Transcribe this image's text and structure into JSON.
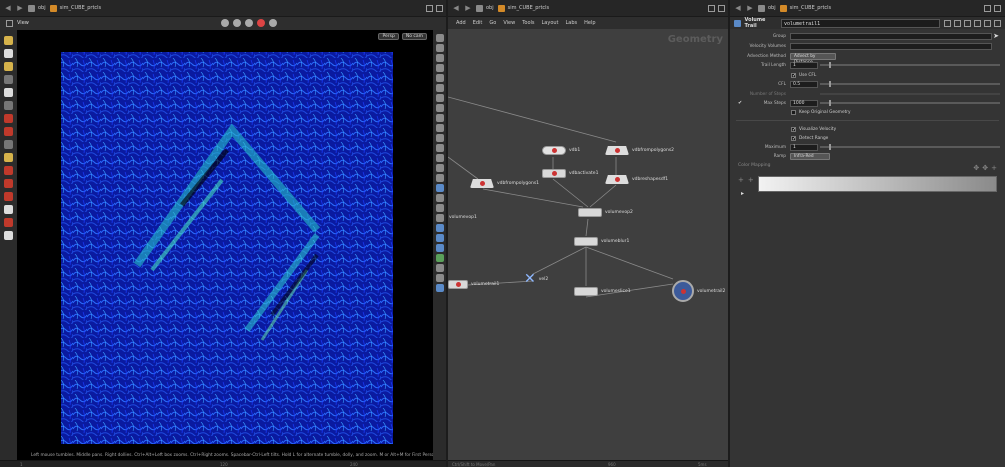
{
  "left_pane": {
    "path": [
      "obj",
      "sim_CUBE_prtcls"
    ],
    "view_title": "View",
    "camera_buttons": [
      "Persp",
      "No cam"
    ],
    "status": "Left mouse tumbles. Middle pans. Right dollies. Ctrl+Alt+Left box zooms. Ctrl+Right zooms. Spacebar-Ctrl-Left tilts. Hold L for alternate tumble, dolly, and zoom.    M or Alt+M for First Person Navigation.",
    "timeline_labels": [
      "1",
      "120",
      "240"
    ]
  },
  "network_pane": {
    "path": [
      "obj",
      "sim_CUBE_prtcls"
    ],
    "menu": [
      "Add",
      "Edit",
      "Go",
      "View",
      "Tools",
      "Layout",
      "Labs",
      "Help"
    ],
    "context_label": "Geometry",
    "nodes": [
      {
        "name": "vdb1"
      },
      {
        "name": "vdbfrompolygons2"
      },
      {
        "name": "vdbactivate1"
      },
      {
        "name": "vdbreshapesdf1"
      },
      {
        "name": "vdbfrompolygons1"
      },
      {
        "name": "volumevop2"
      },
      {
        "name": "volumevop1"
      },
      {
        "name": "volumeblur1"
      },
      {
        "name": "volumetrail1"
      },
      {
        "name": "null",
        "label": "vel2"
      },
      {
        "name": "volumeslice1"
      },
      {
        "name": "volumetrail2"
      }
    ],
    "bottom_labels": [
      "Ctrl/Shift to Move/Pan",
      "960",
      "5ms"
    ]
  },
  "param_pane": {
    "path": [
      "obj",
      "sim_CUBE_prtcls"
    ],
    "node_type": "Volume Trail",
    "node_name": "volumetrail1",
    "group_label": "Group",
    "group_value": "",
    "velocity_volumes_label": "Velocity Volumes",
    "velocity_volumes_value": "",
    "advection_method_label": "Advection Method",
    "advection_method_value": "Advect by Distance",
    "trail_length_label": "Trail Length",
    "trail_length_value": "1",
    "trail_length_fraction": 0.05,
    "use_cfl_label": "Use CFL",
    "use_cfl_checked": true,
    "cfl_label": "CFL",
    "cfl_value": "0.5",
    "cfl_fraction": 0.05,
    "number_of_steps_label": "Number of Steps",
    "max_steps_label": "Max Steps",
    "max_steps_value": "1000",
    "max_steps_fraction": 0.05,
    "keep_original_label": "Keep Original Geometry",
    "keep_original_checked": false,
    "visualize_velocity_label": "Visualize Velocity",
    "visualize_velocity_checked": true,
    "detect_range_label": "Detect Range",
    "detect_range_checked": true,
    "maximum_label": "Maximum",
    "maximum_value": "1",
    "maximum_fraction": 0.05,
    "ramp_label": "Ramp",
    "ramp_value": "Infra-Red",
    "color_mapping_label": "Color Mapping"
  }
}
